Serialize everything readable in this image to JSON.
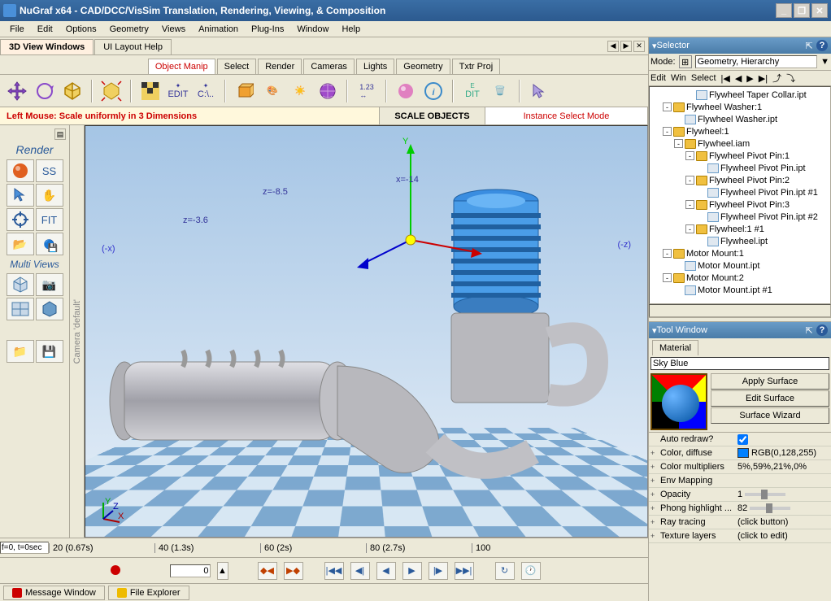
{
  "titlebar": {
    "text": "NuGraf x64 - CAD/DCC/VisSim Translation, Rendering, Viewing, & Composition"
  },
  "menubar": [
    "File",
    "Edit",
    "Options",
    "Geometry",
    "Views",
    "Animation",
    "Plug-Ins",
    "Window",
    "Help"
  ],
  "top_tabs": {
    "active": "3D View Windows",
    "other": "UI Layout Help"
  },
  "secondary_tabs": [
    "Object Manip",
    "Select",
    "Render",
    "Cameras",
    "Lights",
    "Geometry",
    "Txtr Proj"
  ],
  "secondary_active": 0,
  "statusbar": {
    "left": "Left Mouse: Scale uniformly in 3 Dimensions",
    "mid": "SCALE OBJECTS",
    "right": "Instance Select Mode"
  },
  "left_toolbox": {
    "render_label": "Render",
    "ss_label": "SS",
    "fit_label": "FIT",
    "multiviews_label": "Multi Views"
  },
  "vsidebar_text": "Camera 'default'",
  "viewport_labels": {
    "y_axis": "Y",
    "z_label": "z=-8.5",
    "z_label2": "z=-3.6",
    "x_label": "x=-14",
    "neg_x": "(-x)",
    "neg_z": "(-z)",
    "corner": "ZXY"
  },
  "timeline": {
    "input": "f=0, t=0sec",
    "ticks": [
      "20 (0.67s)",
      "40 (1.3s)",
      "60 (2s)",
      "80 (2.7s)",
      "100"
    ]
  },
  "frame_input": "0",
  "bottom_tabs": [
    "Message Window",
    "File Explorer"
  ],
  "selector": {
    "title": "Selector",
    "mode_label": "Mode:",
    "mode_value": "Geometry, Hierarchy",
    "mini_toolbar": [
      "Edit",
      "Win",
      "Select"
    ],
    "tree": [
      {
        "indent": 3,
        "type": "file",
        "label": "Flywheel Taper Collar.ipt"
      },
      {
        "indent": 1,
        "type": "folder",
        "toggle": "-",
        "label": "Flywheel Washer:1"
      },
      {
        "indent": 2,
        "type": "file",
        "label": "Flywheel Washer.ipt"
      },
      {
        "indent": 1,
        "type": "folder",
        "toggle": "-",
        "label": "Flywheel:1"
      },
      {
        "indent": 2,
        "type": "folder",
        "toggle": "-",
        "label": "Flywheel.iam"
      },
      {
        "indent": 3,
        "type": "folder",
        "toggle": "-",
        "label": "Flywheel Pivot Pin:1"
      },
      {
        "indent": 4,
        "type": "file",
        "label": "Flywheel Pivot Pin.ipt"
      },
      {
        "indent": 3,
        "type": "folder",
        "toggle": "-",
        "label": "Flywheel Pivot Pin:2"
      },
      {
        "indent": 4,
        "type": "file",
        "label": "Flywheel Pivot Pin.ipt #1"
      },
      {
        "indent": 3,
        "type": "folder",
        "toggle": "-",
        "label": "Flywheel Pivot Pin:3"
      },
      {
        "indent": 4,
        "type": "file",
        "label": "Flywheel Pivot Pin.ipt #2"
      },
      {
        "indent": 3,
        "type": "folder",
        "toggle": "-",
        "label": "Flywheel:1 #1"
      },
      {
        "indent": 4,
        "type": "file",
        "label": "Flywheel.ipt"
      },
      {
        "indent": 1,
        "type": "folder",
        "toggle": "-",
        "label": "Motor Mount:1"
      },
      {
        "indent": 2,
        "type": "file",
        "label": "Motor Mount.ipt"
      },
      {
        "indent": 1,
        "type": "folder",
        "toggle": "-",
        "label": "Motor Mount:2"
      },
      {
        "indent": 2,
        "type": "file",
        "label": "Motor Mount.ipt #1"
      }
    ]
  },
  "tool_window": {
    "title": "Tool Window",
    "tab": "Material",
    "material_name": "Sky Blue",
    "buttons": [
      "Apply Surface",
      "Edit Surface",
      "Surface Wizard"
    ],
    "props": [
      {
        "key": "Auto redraw?",
        "val": "",
        "checkbox": true
      },
      {
        "exp": "+",
        "key": "Color, diffuse",
        "val": "RGB(0,128,255)",
        "swatch": true
      },
      {
        "exp": "+",
        "key": "Color multipliers",
        "val": "5%,59%,21%,0%"
      },
      {
        "exp": "+",
        "key": "Env Mapping",
        "val": ""
      },
      {
        "exp": "+",
        "key": "Opacity",
        "val": "1",
        "slider": true
      },
      {
        "exp": "+",
        "key": "Phong highlight ...",
        "val": "82",
        "slider": true
      },
      {
        "exp": "+",
        "key": "Ray tracing",
        "val": "(click button)"
      },
      {
        "exp": "+",
        "key": "Texture layers",
        "val": "(click to edit)"
      }
    ]
  }
}
